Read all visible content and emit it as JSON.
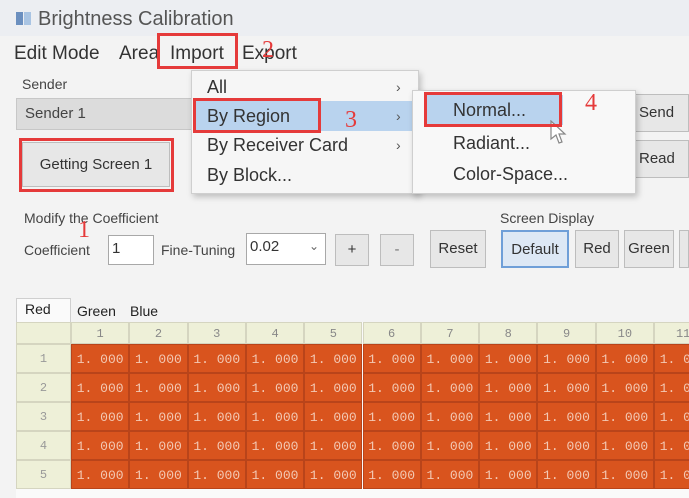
{
  "window": {
    "title": "Brightness Calibration"
  },
  "menubar": {
    "edit_mode": "Edit Mode",
    "area": "Area",
    "import": "Import",
    "export": "Export"
  },
  "sender": {
    "label": "Sender",
    "value": "Sender 1",
    "getting_screen_button": "Getting Screen 1"
  },
  "import_menu": {
    "items": [
      {
        "label": "All",
        "has_submenu": true
      },
      {
        "label": "By Region",
        "has_submenu": true,
        "highlighted": true
      },
      {
        "label": "By Receiver Card",
        "has_submenu": true
      },
      {
        "label": "By Block...",
        "has_submenu": false
      }
    ]
  },
  "by_region_submenu": {
    "items": [
      {
        "label": "Normal...",
        "highlighted": true
      },
      {
        "label": "Radiant..."
      },
      {
        "label": "Color-Space..."
      }
    ]
  },
  "right_buttons": {
    "send": "Send",
    "read": "Read"
  },
  "coefficient_section": {
    "group_title": "Modify the Coefficient",
    "coefficient_label": "Coefficient",
    "coefficient_value": "1",
    "fine_tuning_label": "Fine-Tuning",
    "fine_tuning_value": "0.02",
    "plus": "+",
    "minus": "-",
    "reset": "Reset"
  },
  "screen_display": {
    "title": "Screen Display",
    "buttons": [
      "Default",
      "Red",
      "Green"
    ]
  },
  "color_tabs": [
    "Red",
    "Green",
    "Blue"
  ],
  "table": {
    "column_headers": [
      "1",
      "2",
      "3",
      "4",
      "5",
      "6",
      "7",
      "8",
      "9",
      "10",
      "11"
    ],
    "row_headers": [
      "1",
      "2",
      "3",
      "4",
      "5"
    ],
    "cell_value": "1. 000",
    "cell_color": "#d9541e"
  },
  "annotations": {
    "labels": [
      "1",
      "2",
      "3",
      "4"
    ],
    "color": "#e53a3a"
  },
  "colors": {
    "menu_highlight": "#b9d3ee",
    "selected_button_border": "#6f9fd8"
  }
}
